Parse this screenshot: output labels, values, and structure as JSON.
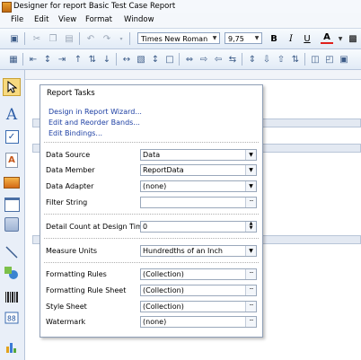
{
  "window": {
    "title": "Designer for report Basic Test Case Report"
  },
  "menu": [
    "File",
    "Edit",
    "View",
    "Format",
    "Window"
  ],
  "toolbar": {
    "font_name": "Times New Roman",
    "font_size": "9,75",
    "bold": "B",
    "italic": "I",
    "underline": "U",
    "font_color": "A"
  },
  "tasks": {
    "title": "Report Tasks",
    "links": [
      "Design in Report Wizard...",
      "Edit and Reorder Bands...",
      "Edit Bindings..."
    ],
    "fields": [
      {
        "label": "Data Source",
        "value": "Data",
        "button": "dropdown"
      },
      {
        "label": "Data Member",
        "value": "ReportData",
        "button": "dropdown"
      },
      {
        "label": "Data Adapter",
        "value": "(none)",
        "button": "dropdown"
      },
      {
        "label": "Filter String",
        "value": "",
        "button": "ellipsis"
      },
      {
        "label": "Detail Count at Design Time",
        "value": "0",
        "button": "spin"
      },
      {
        "label": "Measure Units",
        "value": "Hundredths of an Inch",
        "button": "dropdown"
      },
      {
        "label": "Formatting Rules",
        "value": "(Collection)",
        "button": "ellipsis"
      },
      {
        "label": "Formatting Rule Sheet",
        "value": "(Collection)",
        "button": "ellipsis"
      },
      {
        "label": "Style Sheet",
        "value": "(Collection)",
        "button": "ellipsis"
      },
      {
        "label": "Watermark",
        "value": "(none)",
        "button": "ellipsis"
      }
    ]
  }
}
